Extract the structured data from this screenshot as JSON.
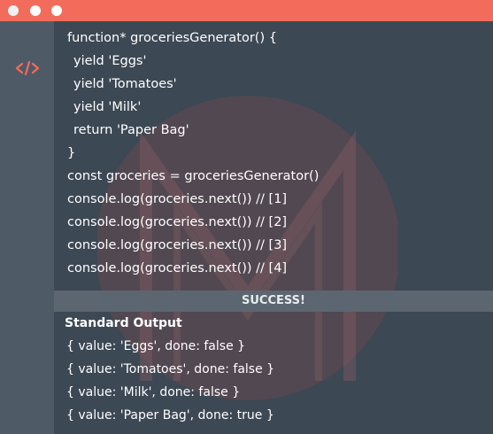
{
  "colors": {
    "titlebar": "#f26b5b",
    "background": "#3c4854",
    "gutter": "#4e5b67",
    "status_bar": "#5c6670",
    "icon": "#f26b5b"
  },
  "gutter": {
    "icon": "code-brackets-icon"
  },
  "code": {
    "lines": [
      "function* groceriesGenerator() {",
      "yield 'Eggs'",
      "yield 'Tomatoes'",
      "yield 'Milk'",
      "return 'Paper Bag'",
      "}",
      "const groceries = groceriesGenerator()",
      "console.log(groceries.next()) // [1]",
      "console.log(groceries.next()) // [2]",
      "console.log(groceries.next()) // [3]",
      "console.log(groceries.next()) // [4]"
    ]
  },
  "status": {
    "label": "SUCCESS!"
  },
  "output": {
    "title": "Standard Output",
    "lines": [
      "{ value: 'Eggs', done: false }",
      "{ value: 'Tomatoes', done: false }",
      "{ value: 'Milk', done: false }",
      "{ value: 'Paper Bag', done: true }"
    ]
  }
}
